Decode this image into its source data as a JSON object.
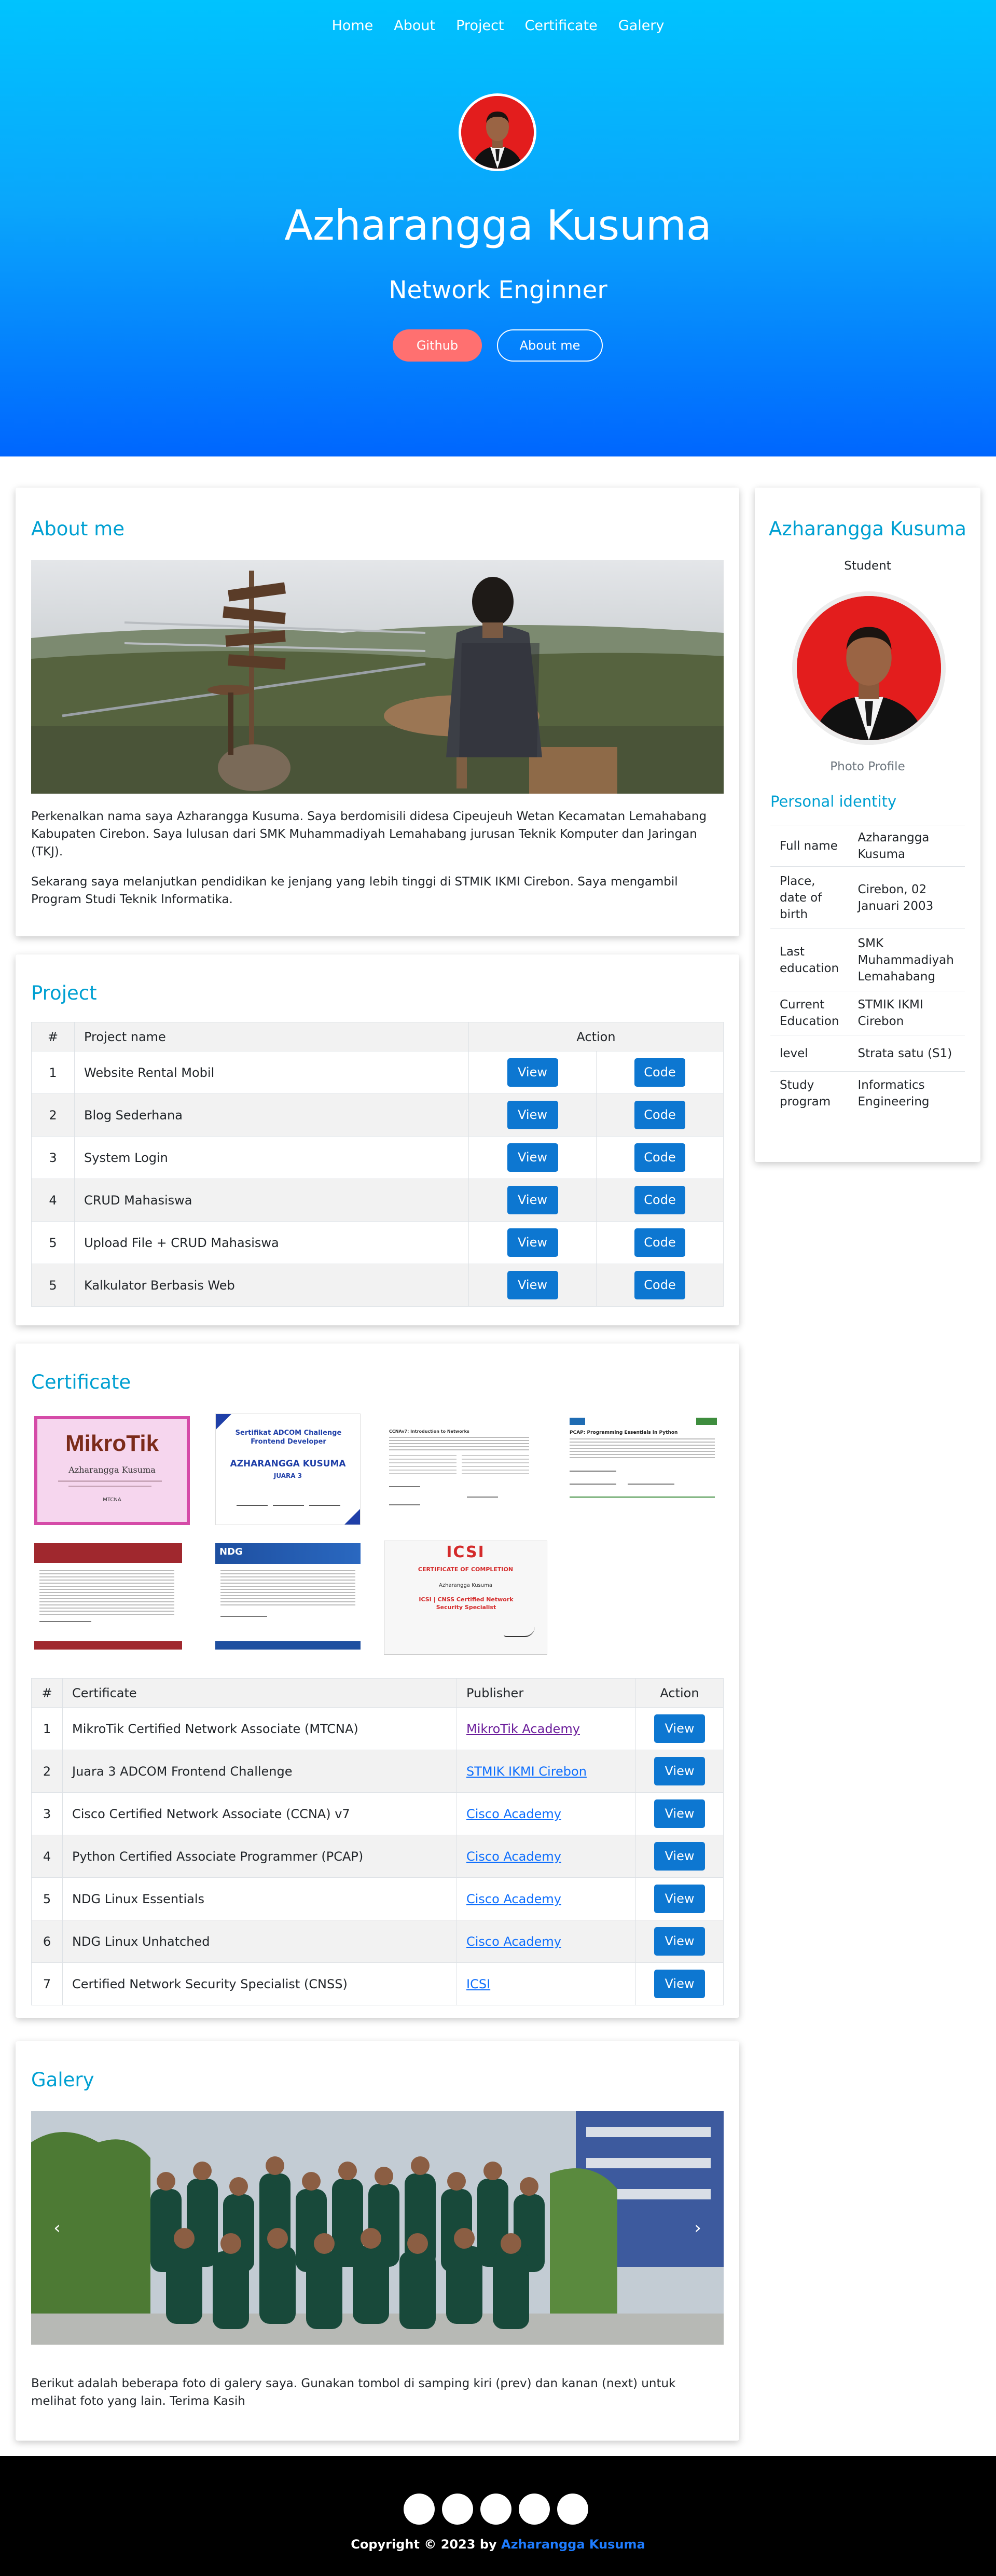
{
  "nav": {
    "items": [
      "Home",
      "About",
      "Project",
      "Certificate",
      "Galery"
    ]
  },
  "hero": {
    "name": "Azharangga Kusuma",
    "role": "Network Enginner",
    "github_label": "Github",
    "about_label": "About me"
  },
  "about": {
    "title": "About me",
    "paragraph1": "Perkenalkan nama saya Azharangga Kusuma. Saya berdomisili didesa Cipeujeuh Wetan Kecamatan Lemahabang Kabupaten Cirebon. Saya lulusan dari SMK Muhammadiyah Lemahabang jurusan Teknik Komputer dan Jaringan (TKJ).",
    "paragraph2": "Sekarang saya melanjutkan pendidikan ke jenjang yang lebih tinggi di STMIK IKMI Cirebon. Saya mengambil Program Studi Teknik Informatika."
  },
  "project": {
    "title": "Project",
    "headers": [
      "#",
      "Project name",
      "Action"
    ],
    "view_label": "View",
    "code_label": "Code",
    "rows": [
      {
        "no": "1",
        "name": "Website Rental Mobil"
      },
      {
        "no": "2",
        "name": "Blog Sederhana"
      },
      {
        "no": "3",
        "name": "System Login"
      },
      {
        "no": "4",
        "name": "CRUD Mahasiswa"
      },
      {
        "no": "5",
        "name": "Upload File + CRUD Mahasiswa"
      },
      {
        "no": "5",
        "name": "Kalkulator Berbasis Web"
      }
    ]
  },
  "certificate": {
    "title": "Certificate",
    "headers": [
      "#",
      "Certificate",
      "Publisher",
      "Action"
    ],
    "view_label": "View",
    "rows": [
      {
        "no": "1",
        "name": "MikroTik Certified Network Associate (MTCNA)",
        "publisher": "MikroTik Academy"
      },
      {
        "no": "2",
        "name": "Juara 3 ADCOM Frontend Challenge",
        "publisher": "STMIK IKMI Cirebon"
      },
      {
        "no": "3",
        "name": "Cisco Certified Network Associate (CCNA) v7",
        "publisher": "Cisco Academy"
      },
      {
        "no": "4",
        "name": "Python Certified Associate Programmer (PCAP)",
        "publisher": "Cisco Academy"
      },
      {
        "no": "5",
        "name": "NDG Linux Essentials",
        "publisher": "Cisco Academy"
      },
      {
        "no": "6",
        "name": "NDG Linux Unhatched",
        "publisher": "Cisco Academy"
      },
      {
        "no": "7",
        "name": "Certified Network Security Specialist (CNSS)",
        "publisher": "ICSI"
      }
    ],
    "thumbs": {
      "mikrotik_logo": "MikroTik",
      "mikrotik_name": "Azharangga Kusuma",
      "mikrotik_code": "MTCNA",
      "adcom_title": "Sertifikat ADCOM Challenge Frontend Developer",
      "adcom_name": "AZHARANGGA KUSUMA",
      "adcom_rank": "JUARA 3",
      "ccna_title": "CCNAv7: Introduction to Networks",
      "pcap_title": "PCAP: Programming Essentials in Python",
      "ndg_logo": "NDG",
      "cnss_logo": "ICSI",
      "cnss_heading": "CERTIFICATE OF COMPLETION",
      "cnss_name": "Azharangga Kusuma",
      "cnss_course": "ICSI | CNSS Certified Network Security Specialist"
    }
  },
  "galery": {
    "title": "Galery",
    "prev_icon": "chevron-left-icon",
    "next_icon": "chevron-right-icon",
    "text": "Berikut adalah beberapa foto di galery saya. Gunakan tombol di samping kiri (prev) dan kanan (next) untuk melihat foto yang lain. Terima Kasih"
  },
  "profile": {
    "name": "Azharangga Kusuma",
    "status": "Student",
    "photo_caption": "Photo Profile",
    "identity_title": "Personal identity",
    "rows": [
      {
        "label": "Full name",
        "value": "Azharangga Kusuma"
      },
      {
        "label": "Place, date of birth",
        "value": "Cirebon, 02 Januari 2003"
      },
      {
        "label": "Last education",
        "value": "SMK Muhammadiyah Lemahabang"
      },
      {
        "label": "Current Education",
        "value": "STMIK IKMI Cirebon"
      },
      {
        "label": "level",
        "value": "Strata satu (S1)"
      },
      {
        "label": "Study program",
        "value": "Informatics Engineering"
      }
    ]
  },
  "footer": {
    "copyright_prefix": "Copyright © 2023 by",
    "author": "Azharangga Kusuma",
    "social_icons": [
      "social-icon-1",
      "social-icon-2",
      "social-icon-3",
      "social-icon-4",
      "social-icon-5"
    ]
  },
  "colors": {
    "hero_top": "#00c3fe",
    "hero_bottom": "#0066fe",
    "accent_title": "#00a0d2",
    "button_blue": "#0d77d1",
    "github_button": "#ff7070"
  }
}
